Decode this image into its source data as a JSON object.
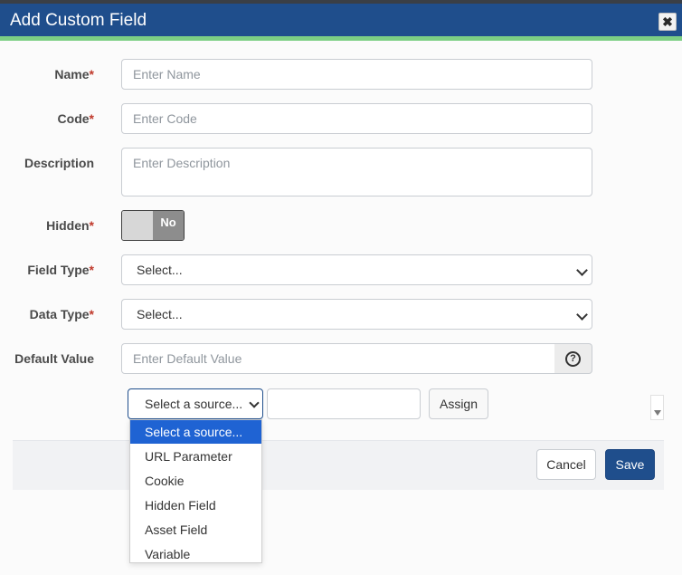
{
  "dialog": {
    "title": "Add Custom Field",
    "close_glyph": "✖"
  },
  "colors": {
    "header": "#1f4e8c",
    "accent": "#7ccf84",
    "primary_button": "#1f4e8c",
    "selected_option": "#1f63d3",
    "required_marker": "#c0392b"
  },
  "form": {
    "name": {
      "label": "Name",
      "required": "*",
      "placeholder": "Enter Name",
      "value": ""
    },
    "code": {
      "label": "Code",
      "required": "*",
      "placeholder": "Enter Code",
      "value": ""
    },
    "description": {
      "label": "Description",
      "placeholder": "Enter Description",
      "value": ""
    },
    "hidden": {
      "label": "Hidden",
      "required": "*",
      "state": "No"
    },
    "field_type": {
      "label": "Field Type",
      "required": "*",
      "value": "Select..."
    },
    "data_type": {
      "label": "Data Type",
      "required": "*",
      "value": "Select..."
    },
    "default_value": {
      "label": "Default Value",
      "placeholder": "Enter Default Value",
      "value": "",
      "help_glyph": "?"
    }
  },
  "source": {
    "selected": "Select a source...",
    "text_value": "",
    "assign_label": "Assign",
    "options": [
      "Select a source...",
      "URL Parameter",
      "Cookie",
      "Hidden Field",
      "Asset Field",
      "Variable"
    ]
  },
  "footer": {
    "cancel_label": "Cancel",
    "save_label": "Save"
  }
}
